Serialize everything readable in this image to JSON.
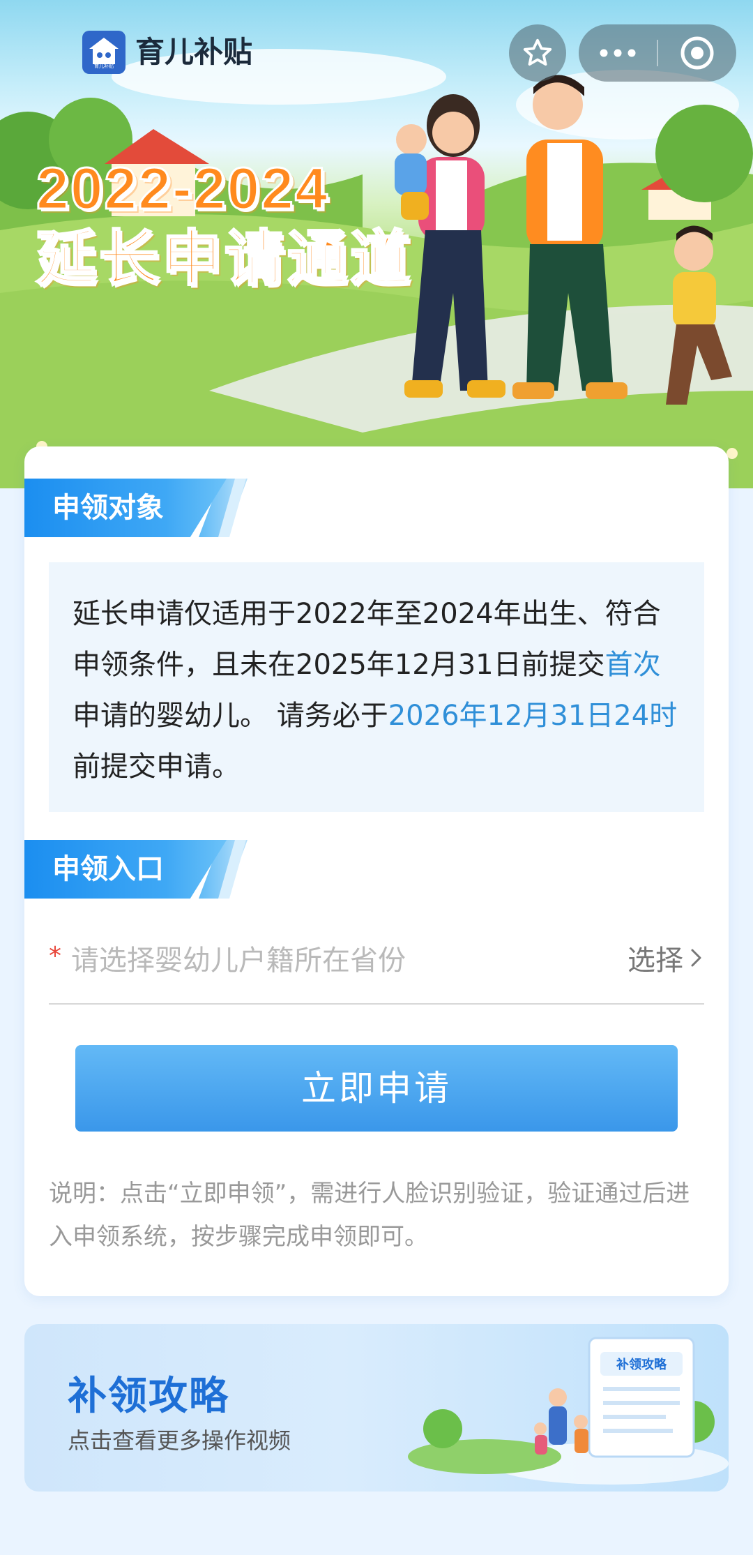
{
  "nav": {
    "app_title": "育儿补贴",
    "logo_text": "育儿补贴",
    "favorite_icon": "star-icon",
    "more_icon": "more-dots-icon",
    "close_icon": "target-close-icon"
  },
  "hero": {
    "title": "2022-2024",
    "subtitle": "延长申请通道"
  },
  "eligibility": {
    "tag": "申领对象",
    "text_1": "延长申请仅适用于2022年至2024年出生、符合申领条件，且未在2025年12月31日前提交",
    "highlight_1": "首次",
    "text_2": "申请的婴幼儿。 请务必于",
    "highlight_2": "2026年12月31日24时",
    "text_3": "前提交申请。"
  },
  "entry": {
    "tag": "申领入口",
    "required_mark": "*",
    "province_placeholder": "请选择婴幼儿户籍所在省份",
    "select_label": "选择",
    "apply_button": "立即申请",
    "note": "说明：点击“立即申领”，需进行人脸识别验证，验证通过后进入申领系统，按步骤完成申领即可。"
  },
  "guide": {
    "title": "补领攻略",
    "subtitle": "点击查看更多操作视频",
    "doc_label": "补领攻略"
  },
  "colors": {
    "accent_blue": "#2f8fd8",
    "button_blue": "#3a97ea",
    "hero_orange": "#ff8a1e",
    "required_red": "#e8463a"
  }
}
